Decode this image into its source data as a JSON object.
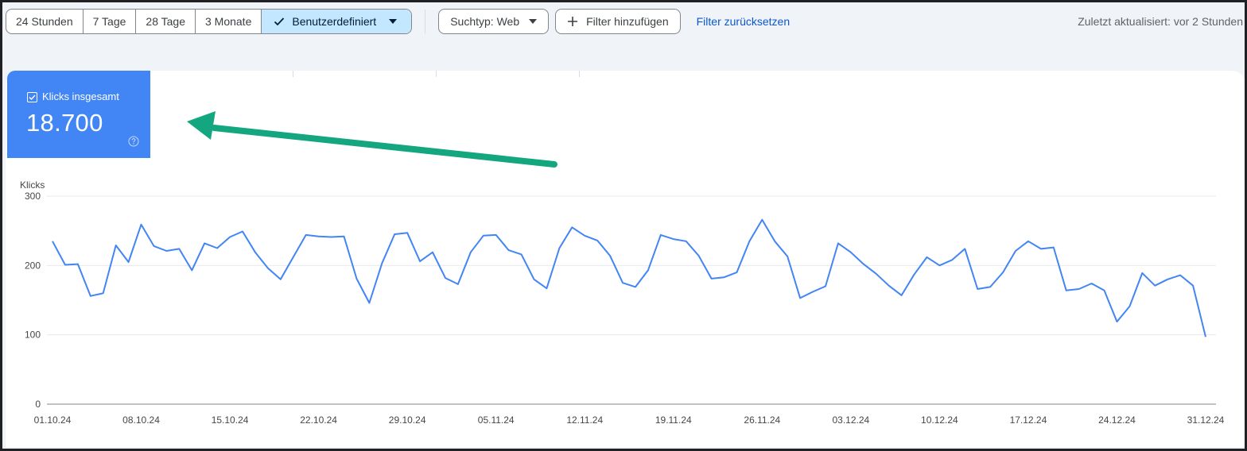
{
  "toolbar": {
    "ranges": [
      "24 Stunden",
      "7 Tage",
      "28 Tage",
      "3 Monate"
    ],
    "custom_label": "Benutzerdefiniert",
    "search_type": "Suchtyp: Web",
    "add_filter": "Filter hinzufügen",
    "reset_filter": "Filter zurücksetzen",
    "updated": "Zuletzt aktualisiert: vor 2 Stunden"
  },
  "metric": {
    "label": "Klicks insgesamt",
    "value": "18.700"
  },
  "colors": {
    "accent": "#4285f4",
    "line": "#4285f4",
    "annotation_arrow": "#14a77f",
    "selected_range": "#c2e7ff",
    "link": "#0b57d0"
  },
  "chart_data": {
    "type": "line",
    "ylabel": "Klicks",
    "ylim": [
      0,
      300
    ],
    "yticks": [
      0,
      100,
      200,
      300
    ],
    "grid": true,
    "x_ticks": [
      "01.10.24",
      "08.10.24",
      "15.10.24",
      "22.10.24",
      "29.10.24",
      "05.11.24",
      "12.11.24",
      "19.11.24",
      "26.11.24",
      "03.12.24",
      "10.12.24",
      "17.12.24",
      "24.12.24",
      "31.12.24"
    ],
    "series": [
      {
        "values": [
          235,
          201,
          202,
          156,
          160,
          229,
          205,
          259,
          228,
          221,
          224,
          193,
          232,
          225,
          241,
          249,
          219,
          196,
          180,
          212,
          244,
          242,
          241,
          242,
          181,
          146,
          203,
          245,
          247,
          206,
          219,
          182,
          173,
          219,
          243,
          244,
          222,
          216,
          180,
          167,
          225,
          255,
          243,
          236,
          214,
          175,
          169,
          193,
          244,
          238,
          235,
          214,
          181,
          183,
          190,
          235,
          266,
          235,
          213,
          153,
          162,
          170,
          232,
          219,
          202,
          188,
          171,
          157,
          187,
          212,
          200,
          208,
          224,
          166,
          169,
          190,
          221,
          235,
          224,
          226,
          164,
          166,
          174,
          164,
          119,
          141,
          189,
          171,
          180,
          186,
          171,
          97
        ]
      }
    ]
  }
}
